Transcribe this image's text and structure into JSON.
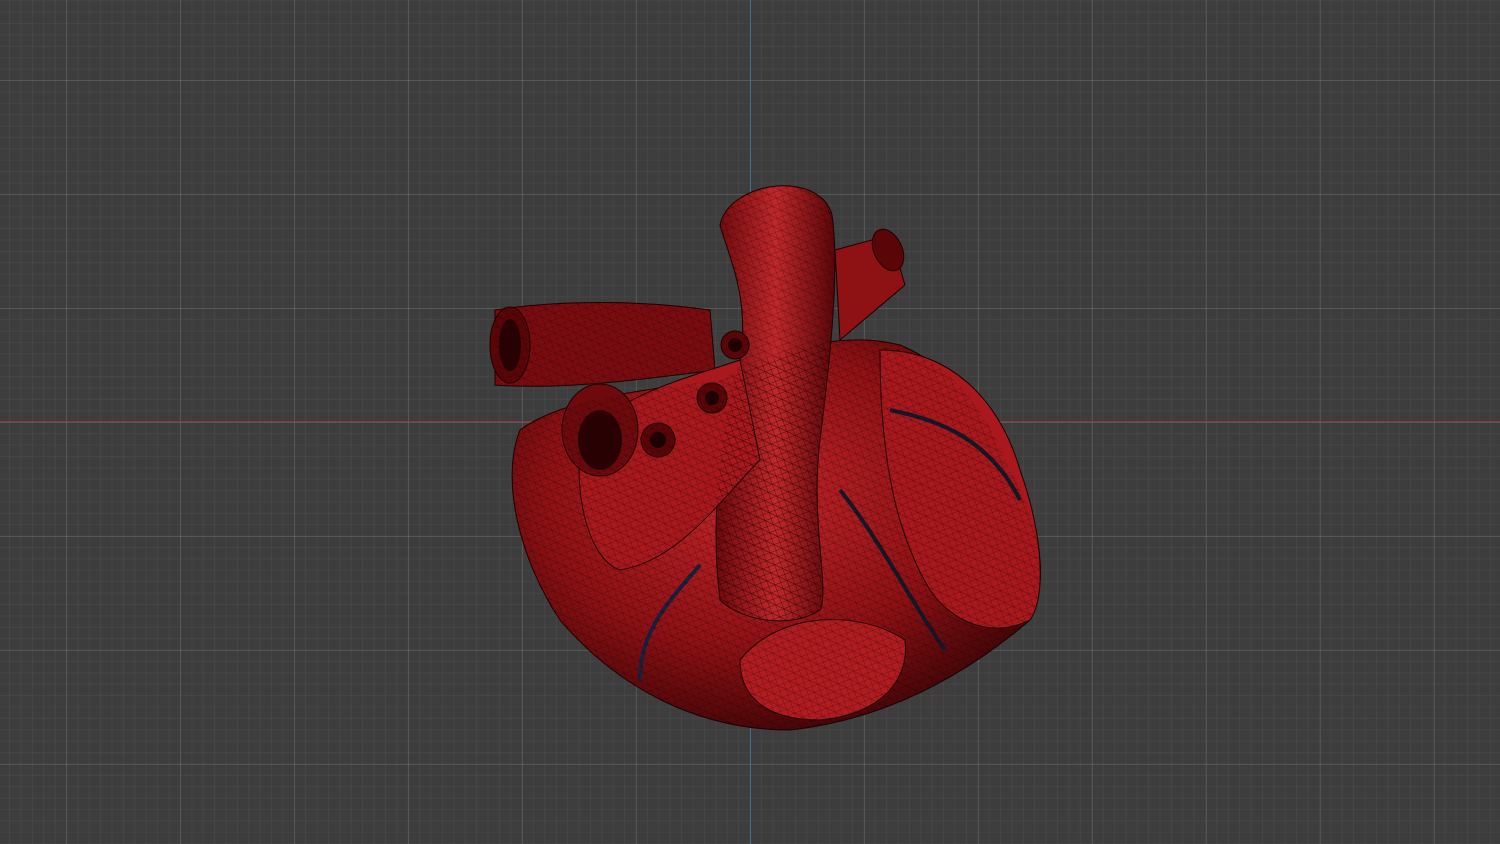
{
  "viewport": {
    "background_color": "#3d3d3d",
    "x_axis_color": "#8a3a3f",
    "y_axis_color": "#3f6a9a",
    "model_color": "#9a1418",
    "model_icon": "heart-mesh-icon"
  }
}
